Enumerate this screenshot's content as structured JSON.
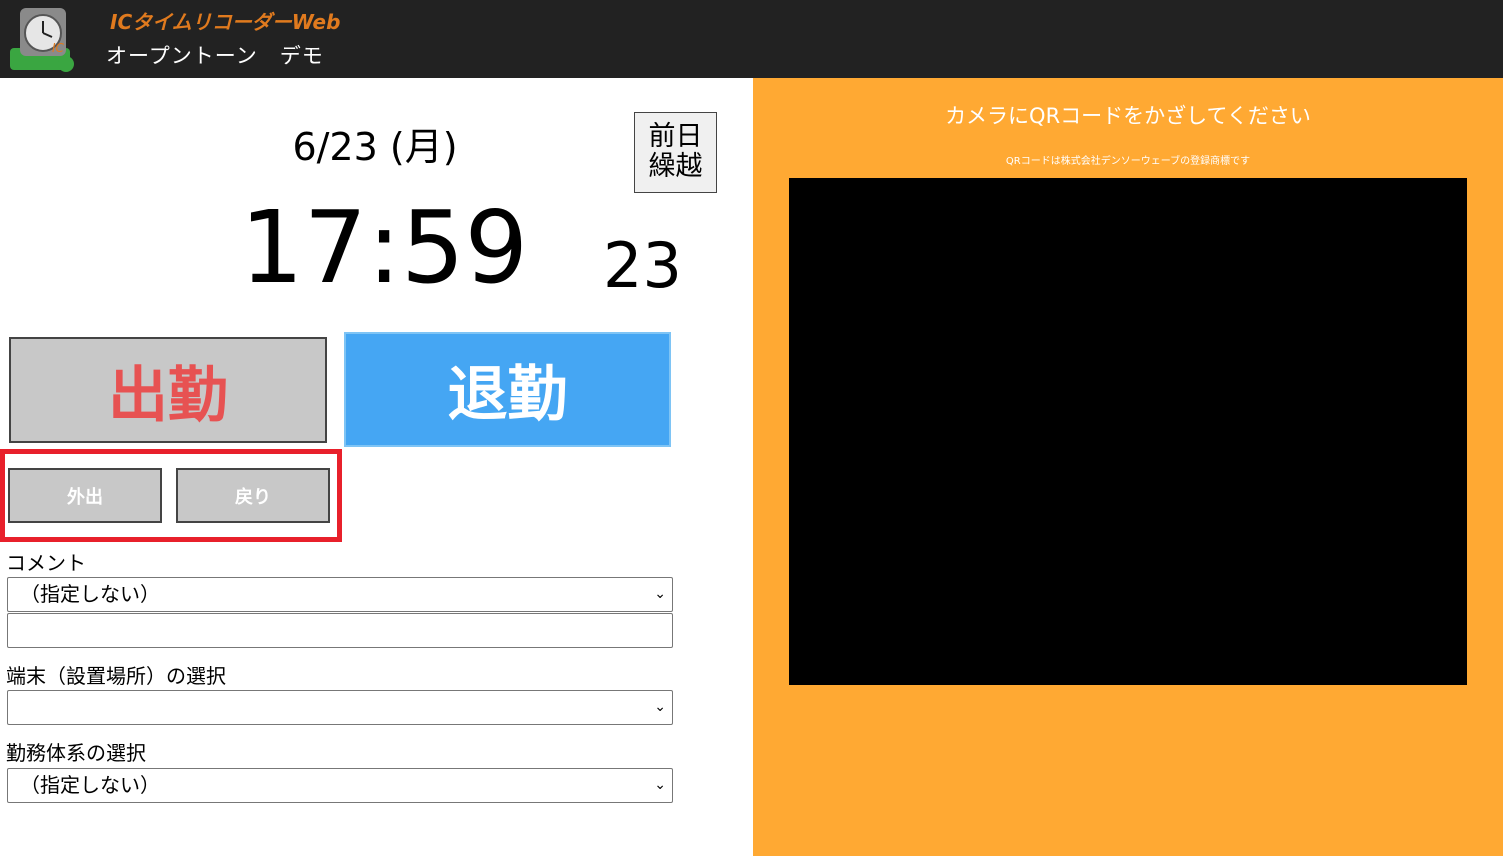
{
  "header": {
    "app_title": "ICタイムリコーダーWeb",
    "company": "オープントーン　デモ"
  },
  "clock": {
    "date": "6/23 (月)",
    "time": "17:59",
    "seconds": "23",
    "carry_over_line1": "前日",
    "carry_over_line2": "繰越"
  },
  "buttons": {
    "clock_in": "出勤",
    "clock_out": "退勤",
    "go_out": "外出",
    "return": "戻り"
  },
  "form": {
    "comment_label": "コメント",
    "comment_select": "（指定しない）",
    "comment_text": "",
    "terminal_label": "端末（設置場所）の選択",
    "terminal_select": "",
    "work_system_label": "勤務体系の選択",
    "work_system_select": "（指定しない）"
  },
  "camera": {
    "prompt": "カメラにQRコードをかざしてください",
    "trademark_note": "QRコードは株式会社デンソーウェーブの登録商標です"
  },
  "icons": {
    "logo": "clock-logo-icon",
    "dropdown": "chevron-down-icon"
  },
  "colors": {
    "header_bg": "#222222",
    "app_title": "#e07a1e",
    "clock_in_text": "#e75252",
    "clock_out_bg": "#45a6f3",
    "camera_panel_bg": "#ffa933",
    "highlight": "#e8202b"
  }
}
